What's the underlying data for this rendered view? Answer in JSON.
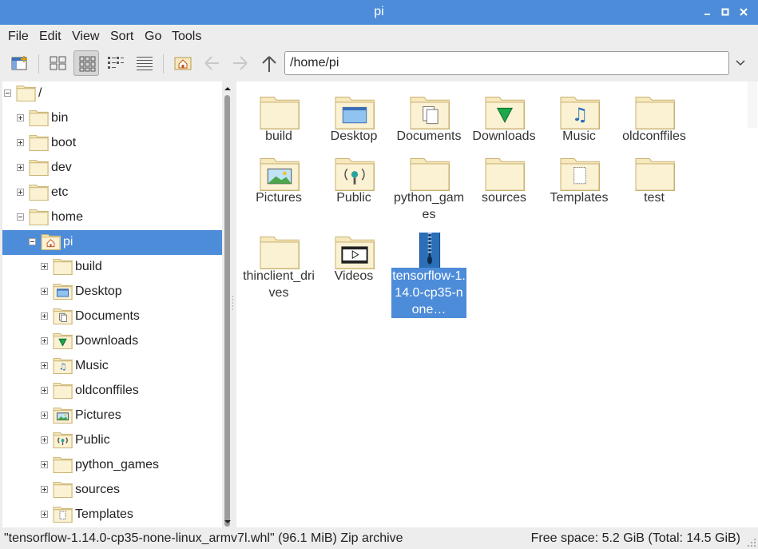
{
  "window": {
    "title": "pi"
  },
  "menus": [
    "File",
    "Edit",
    "View",
    "Sort",
    "Go",
    "Tools"
  ],
  "path": {
    "value": "/home/pi"
  },
  "tree": [
    {
      "label": "/",
      "depth": 0,
      "expanded": true,
      "icon": "folder-icon"
    },
    {
      "label": "bin",
      "depth": 1,
      "expanded": false,
      "icon": "folder-icon"
    },
    {
      "label": "boot",
      "depth": 1,
      "expanded": false,
      "icon": "folder-icon"
    },
    {
      "label": "dev",
      "depth": 1,
      "expanded": false,
      "icon": "folder-icon"
    },
    {
      "label": "etc",
      "depth": 1,
      "expanded": false,
      "icon": "folder-icon"
    },
    {
      "label": "home",
      "depth": 1,
      "expanded": true,
      "icon": "folder-icon"
    },
    {
      "label": "pi",
      "depth": 2,
      "expanded": true,
      "icon": "home-folder-icon",
      "selected": true
    },
    {
      "label": "build",
      "depth": 3,
      "expanded": false,
      "icon": "folder-icon"
    },
    {
      "label": "Desktop",
      "depth": 3,
      "expanded": false,
      "icon": "desktop-folder-icon"
    },
    {
      "label": "Documents",
      "depth": 3,
      "expanded": false,
      "icon": "documents-folder-icon"
    },
    {
      "label": "Downloads",
      "depth": 3,
      "expanded": false,
      "icon": "downloads-folder-icon"
    },
    {
      "label": "Music",
      "depth": 3,
      "expanded": false,
      "icon": "music-folder-icon"
    },
    {
      "label": "oldconffiles",
      "depth": 3,
      "expanded": false,
      "icon": "folder-icon"
    },
    {
      "label": "Pictures",
      "depth": 3,
      "expanded": false,
      "icon": "pictures-folder-icon"
    },
    {
      "label": "Public",
      "depth": 3,
      "expanded": false,
      "icon": "public-folder-icon"
    },
    {
      "label": "python_games",
      "depth": 3,
      "expanded": false,
      "icon": "folder-icon"
    },
    {
      "label": "sources",
      "depth": 3,
      "expanded": false,
      "icon": "folder-icon"
    },
    {
      "label": "Templates",
      "depth": 3,
      "expanded": false,
      "icon": "templates-folder-icon"
    }
  ],
  "files": [
    {
      "label": "build",
      "icon": "folder-icon"
    },
    {
      "label": "Desktop",
      "icon": "desktop-folder-icon"
    },
    {
      "label": "Documents",
      "icon": "documents-folder-icon"
    },
    {
      "label": "Downloads",
      "icon": "downloads-folder-icon"
    },
    {
      "label": "Music",
      "icon": "music-folder-icon"
    },
    {
      "label": "oldconffiles",
      "icon": "folder-icon"
    },
    {
      "label": "Pictures",
      "icon": "pictures-folder-icon"
    },
    {
      "label": "Public",
      "icon": "public-folder-icon"
    },
    {
      "label": "python_games",
      "icon": "folder-icon"
    },
    {
      "label": "sources",
      "icon": "folder-icon"
    },
    {
      "label": "Templates",
      "icon": "templates-folder-icon"
    },
    {
      "label": "test",
      "icon": "folder-icon"
    },
    {
      "label": "thinclient_drives",
      "icon": "folder-icon"
    },
    {
      "label": "Videos",
      "icon": "videos-folder-icon"
    },
    {
      "label": "tensorflow-1.14.0-cp35-none…",
      "icon": "zip-archive-icon",
      "selected": true
    }
  ],
  "status": {
    "left": "\"tensorflow-1.14.0-cp35-none-linux_armv7l.whl\" (96.1 MiB) Zip archive",
    "right": "Free space: 5.2 GiB (Total: 14.5 GiB)"
  },
  "colors": {
    "titlebar": "#4d8cd9",
    "selection": "#4d8cd9",
    "folder": "#f7e8bd",
    "zip": "#2a6fb8"
  }
}
